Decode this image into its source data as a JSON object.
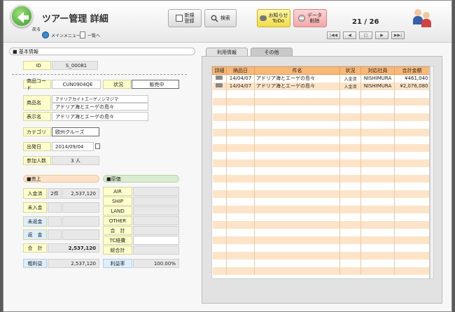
{
  "header": {
    "title": "ツアー管理 詳細",
    "back_label": "戻る",
    "menu_label": "メインメニュー",
    "list_label": "一覧へ",
    "new_line1": "新規",
    "new_line2": "登録",
    "search_label": "検索",
    "notice_line1": "お知らせ",
    "notice_line2": "ToDo",
    "delete_line1": "データ",
    "delete_line2": "削除",
    "record_counter": "21 / 26"
  },
  "basic": {
    "section_title": "■ 基本情報",
    "id_label": "ID",
    "id_value": "S_00081",
    "code_label": "商品コード",
    "code_value": "CUN0904QE",
    "status_label": "状況",
    "status_value": "販売中",
    "name_label": "商品名",
    "name_line1": "アドリアカイトエーゲノシマジマ",
    "name_line2": "アドリア海とエーゲの島々",
    "display_label": "表示名",
    "display_value": "アドリア海とエーゲの島々",
    "category_label": "カテゴリ",
    "category_value": "欧州クルーズ",
    "departure_label": "出発日",
    "departure_value": "2014/09/04",
    "participants_label": "参加人数",
    "participants_value": "3 人"
  },
  "sales": {
    "section_title": "■売上",
    "rows": [
      {
        "label": "入金済",
        "count": "2件",
        "amount": "2,537,120"
      },
      {
        "label": "未入金",
        "count": "",
        "amount": ""
      },
      {
        "label": "未返金",
        "count": "",
        "amount": ""
      },
      {
        "label": "返　金",
        "count": "",
        "amount": ""
      }
    ],
    "total_label": "合　計",
    "total_value": "2,537,120",
    "gross_label": "粗利益",
    "gross_value": "2,537,120"
  },
  "cost": {
    "section_title": "■原価",
    "rows": [
      "AIR",
      "SHIP",
      "LAND",
      "OTHER",
      "合　計",
      "TC経費",
      "総合計"
    ],
    "margin_label": "利益率",
    "margin_value": "100.00%"
  },
  "tabs": [
    "利用情報",
    "その他"
  ],
  "usage_table": {
    "columns": [
      "詳細",
      "納品日",
      "件名",
      "状況",
      "対応社員",
      "合計金額"
    ],
    "rows": [
      {
        "date": "14/04/07",
        "subject": "アドリア海とエーゲの島々",
        "status": "入金済",
        "staff": "NISHIMURA",
        "amount": "¥461,040"
      },
      {
        "date": "14/04/07",
        "subject": "アドリア海とエーゲの島々",
        "status": "入金済",
        "staff": "NISHIMURA",
        "amount": "¥2,076,080"
      }
    ]
  },
  "colors": {
    "header_row": "#f8b878",
    "stripe": "#fde4c8",
    "label_bg": "#ffffcc",
    "sales_section": "#fde2c6",
    "cost_section": "#d9ecd0"
  }
}
